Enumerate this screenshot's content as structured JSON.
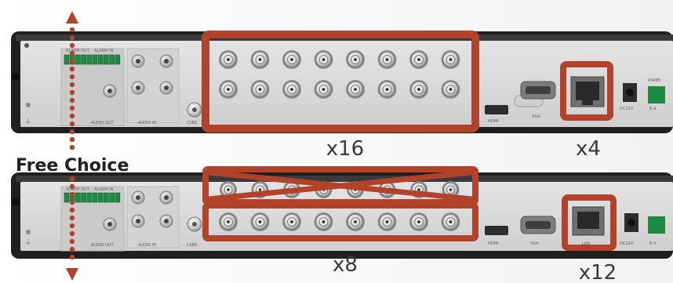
{
  "free_choice_label": "Free Choice",
  "colors": {
    "highlight": "#b3422a",
    "arrow": "#b3422a",
    "chassis": "#d9d9d9",
    "chassis_dark": "#1e1e1e",
    "background": "#ffffff"
  },
  "top_unit": {
    "bnc_count": "x16",
    "lan_count": "x4",
    "port_labels": {
      "audio_out": "AUDIO OUT",
      "audio_in": "AUDIO IN",
      "cvbs": "CVBS",
      "hdmi": "HDMI",
      "vga": "VGA",
      "dc": "DC12V",
      "rs485": "RS485",
      "rs485_sub": "B  A",
      "alarm_out": "ALARM OUT",
      "alarm_in": "ALARM IN"
    }
  },
  "bottom_unit": {
    "bnc_count": "x8",
    "lan_count": "x12",
    "port_labels": {
      "audio_out": "AUDIO OUT",
      "audio_in": "AUDIO IN",
      "cvbs": "CVBS",
      "hdmi": "HDMI",
      "vga": "VGA",
      "lan": "LAN",
      "dc": "DC12V",
      "rs485_sub": "B  A",
      "alarm_out": "ALARM OUT",
      "alarm_in": "ALARM IN"
    }
  }
}
